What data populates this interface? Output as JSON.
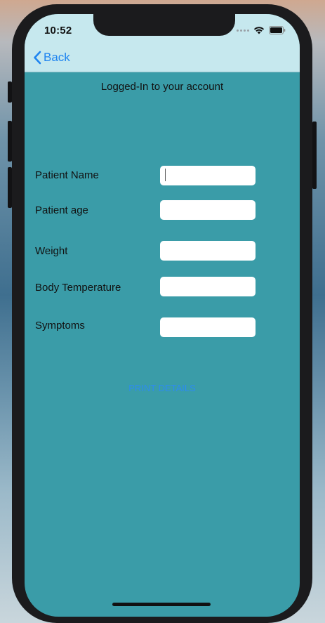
{
  "status_bar": {
    "time": "10:52"
  },
  "nav": {
    "back_label": "Back"
  },
  "header": {
    "title": "Logged-In to your account"
  },
  "form": {
    "fields": [
      {
        "label": "Patient Name",
        "value": ""
      },
      {
        "label": "Patient age",
        "value": ""
      },
      {
        "label": "Weight",
        "value": ""
      },
      {
        "label": "Body Temperature",
        "value": ""
      },
      {
        "label": "Symptoms",
        "value": ""
      }
    ],
    "print_label": "PRINT DETAILS"
  },
  "colors": {
    "screen_background": "#3a9ca8",
    "nav_background": "#c6e8ee",
    "accent": "#1e84f0"
  }
}
